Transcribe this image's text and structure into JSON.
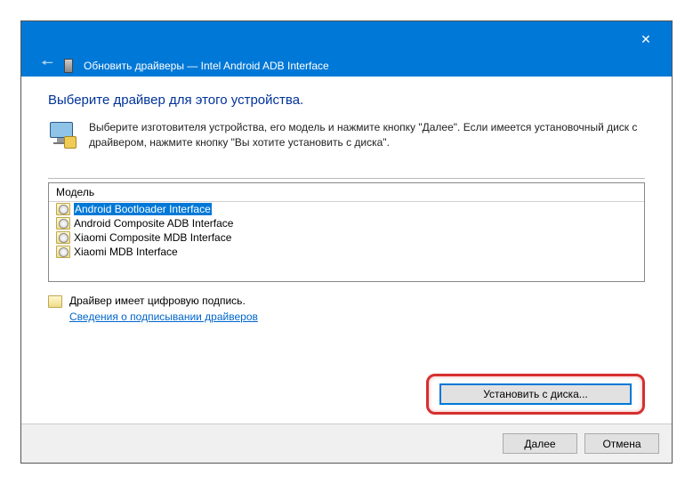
{
  "titlebar": {
    "title": "Обновить драйверы — Intel Android ADB Interface"
  },
  "heading": "Выберите драйвер для этого устройства.",
  "instruction": "Выберите изготовителя устройства, его модель и нажмите кнопку \"Далее\". Если имеется установочный диск с драйвером, нажмите кнопку \"Вы хотите установить с диска\".",
  "list": {
    "header": "Модель",
    "items": [
      {
        "label": "Android Bootloader Interface",
        "selected": true
      },
      {
        "label": "Android Composite ADB Interface",
        "selected": false
      },
      {
        "label": "Xiaomi Composite MDB Interface",
        "selected": false
      },
      {
        "label": "Xiaomi MDB Interface",
        "selected": false
      }
    ]
  },
  "signature": {
    "text": "Драйвер имеет цифровую подпись.",
    "link": "Сведения о подписывании драйверов"
  },
  "buttons": {
    "install_from_disk": "Установить с диска...",
    "next": "Далее",
    "cancel": "Отмена"
  }
}
